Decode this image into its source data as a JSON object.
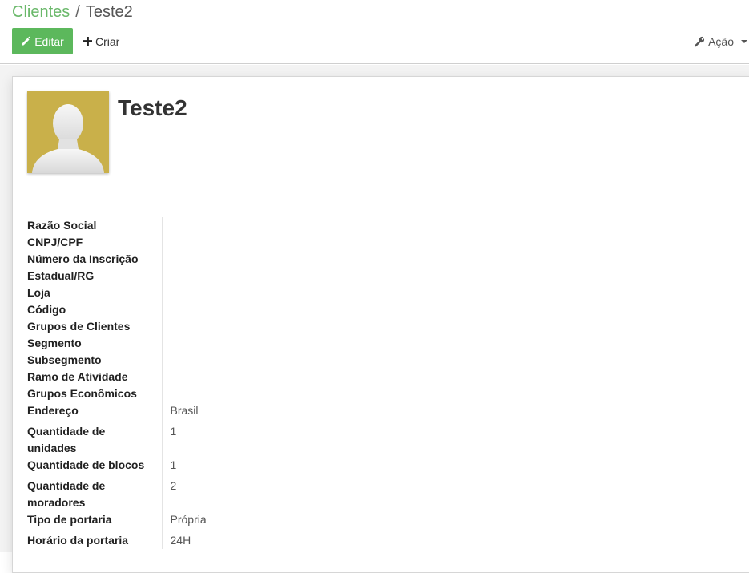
{
  "breadcrumb": {
    "parent": "Clientes",
    "separator": "/",
    "current": "Teste2"
  },
  "toolbar": {
    "edit_label": "Editar",
    "create_label": "Criar",
    "action_label": "Ação"
  },
  "record": {
    "title": "Teste2"
  },
  "fields": [
    {
      "label": "Razão Social",
      "value": ""
    },
    {
      "label": "CNPJ/CPF",
      "value": ""
    },
    {
      "label": "Número da Inscrição Estadual/RG",
      "value": ""
    },
    {
      "label": "Loja",
      "value": ""
    },
    {
      "label": "Código",
      "value": ""
    },
    {
      "label": "Grupos de Clientes",
      "value": ""
    },
    {
      "label": "Segmento",
      "value": ""
    },
    {
      "label": "Subsegmento",
      "value": ""
    },
    {
      "label": "Ramo de Atividade",
      "value": ""
    },
    {
      "label": "Grupos Econômicos",
      "value": ""
    },
    {
      "label": "Endereço",
      "value": "Brasil"
    },
    {
      "label": "Quantidade de unidades",
      "value": "1"
    },
    {
      "label": "Quantidade de blocos",
      "value": "1"
    },
    {
      "label": "Quantidade de moradores",
      "value": "2"
    },
    {
      "label": "Tipo de portaria",
      "value": "Própria"
    },
    {
      "label": "Horário da portaria",
      "value": "24H"
    }
  ],
  "icons": {
    "edit": "pencil-icon",
    "create": "plus-icon",
    "action": "wrench-icon",
    "avatar": "person-silhouette-icon"
  },
  "colors": {
    "accent": "#5cb85c",
    "avatar_bg": "#c9b04a"
  }
}
